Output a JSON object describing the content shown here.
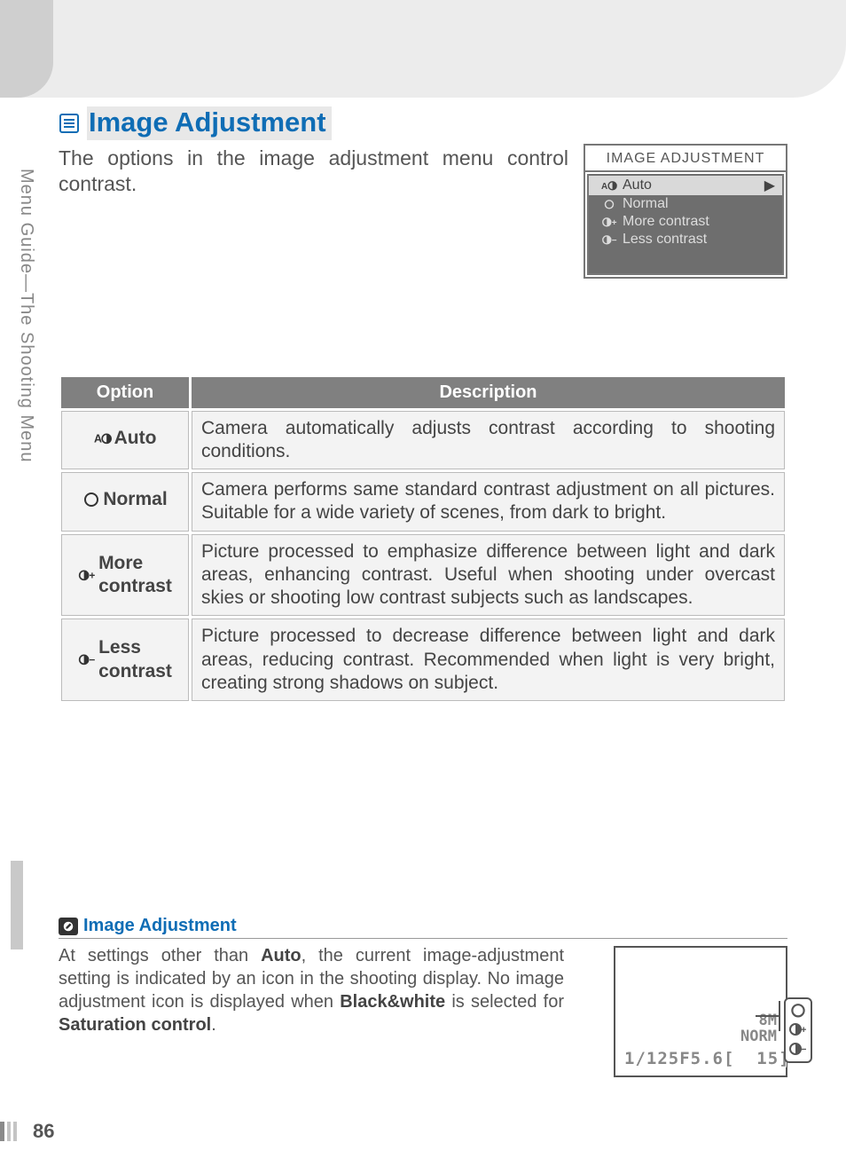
{
  "side_label": "Menu Guide—The Shooting Menu",
  "title": "Image Adjustment",
  "intro": "The options in the image adjustment menu control contrast.",
  "menu": {
    "title": "IMAGE ADJUSTMENT",
    "items": [
      "Auto",
      "Normal",
      "More contrast",
      "Less contrast"
    ]
  },
  "table": {
    "headers": [
      "Option",
      "Description"
    ],
    "rows": [
      {
        "option": "Auto",
        "description": "Camera automatically adjusts contrast according to shooting conditions."
      },
      {
        "option": "Normal",
        "description": "Camera performs same standard contrast adjustment on all pictures. Suitable for a wide variety of scenes, from dark to bright."
      },
      {
        "option_l1": "More",
        "option_l2": "contrast",
        "description": "Picture processed to emphasize difference between light and dark areas, enhancing contrast.  Useful when shooting under overcast skies or shooting low contrast subjects such as landscapes."
      },
      {
        "option_l1": "Less",
        "option_l2": "contrast",
        "description": "Picture processed to decrease difference between light and dark areas, reducing contrast.  Recommended when light is very bright, creating strong shadows on subject."
      }
    ]
  },
  "note": {
    "title": "Image Adjustment",
    "body": [
      "At settings other than ",
      "Auto",
      ", the current image-adjustment setting is indicated by an icon in the shooting display.  No image adjustment icon is displayed when ",
      "Black&white",
      " is selected for ",
      "Saturation control",
      "."
    ]
  },
  "lcd": {
    "size": "8M",
    "quality": "NORM",
    "shutter": "1/125",
    "aperture": "F5.6",
    "shots": "15"
  },
  "page_number": "86"
}
